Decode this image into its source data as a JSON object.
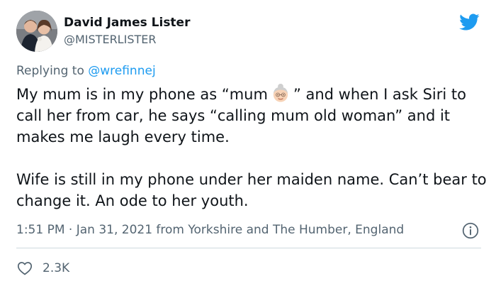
{
  "tweet": {
    "author_name": "David James Lister",
    "author_handle": "@MISTERLISTER",
    "replying_prefix": "Replying to",
    "replying_to": "@wrefinnej",
    "text_p1_a": "My mum is in my phone as “mum",
    "text_p1_b": "” and when I ask Siri to call her from car, he says “calling mum old woman” and it makes me laugh every time.",
    "text_p2": "Wife is still in my phone under her maiden name. Can’t bear to change it. An ode to her youth.",
    "timestamp": "1:51 PM · Jan 31, 2021 from Yorkshire and The Humber, England",
    "like_count": "2.3K"
  },
  "icons": {
    "brand": "twitter-bird-icon",
    "emoji": "old-woman-emoji",
    "info": "info-icon",
    "like": "heart-icon"
  },
  "colors": {
    "accent": "#1d9bf0",
    "text": "#0f1419",
    "secondary": "#536471",
    "divider": "#cfd9de"
  }
}
